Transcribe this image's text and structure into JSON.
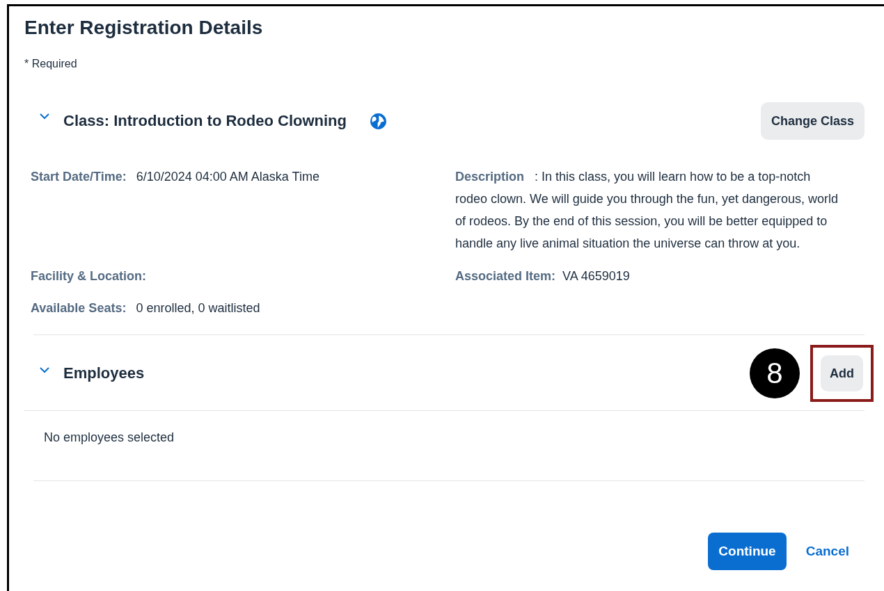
{
  "page": {
    "title": "Enter Registration Details",
    "required_note": "* Required"
  },
  "class_section": {
    "title": "Class: Introduction to Rodeo Clowning",
    "expanded": true,
    "change_button": "Change Class",
    "rows": [
      {
        "left": {
          "label": "Start Date/Time:",
          "value": "6/10/2024 04:00 AM Alaska Time"
        },
        "right": {
          "label": "Description",
          "value": ": In this class, you will learn how to be a top-notch rodeo clown. We will guide you through the fun, yet dangerous, world of rodeos. By the end of this session, you will be better equipped to handle any live animal situation the universe can throw at you.",
          "kind": "paragraph"
        }
      },
      {
        "left": {
          "label": "Facility & Location:"
        },
        "right": {
          "label": "Associated Item:",
          "value": "VA 4659019"
        }
      },
      {
        "left": {
          "label": "Available Seats:",
          "value": "0 enrolled, 0 waitlisted"
        }
      }
    ]
  },
  "employees_section": {
    "title": "Employees",
    "expanded": true,
    "add_button": "Add",
    "highlighted": true,
    "step_marker": "8",
    "empty_text": "No employees selected"
  },
  "footer": {
    "continue_button": "Continue",
    "cancel_link": "Cancel"
  }
}
